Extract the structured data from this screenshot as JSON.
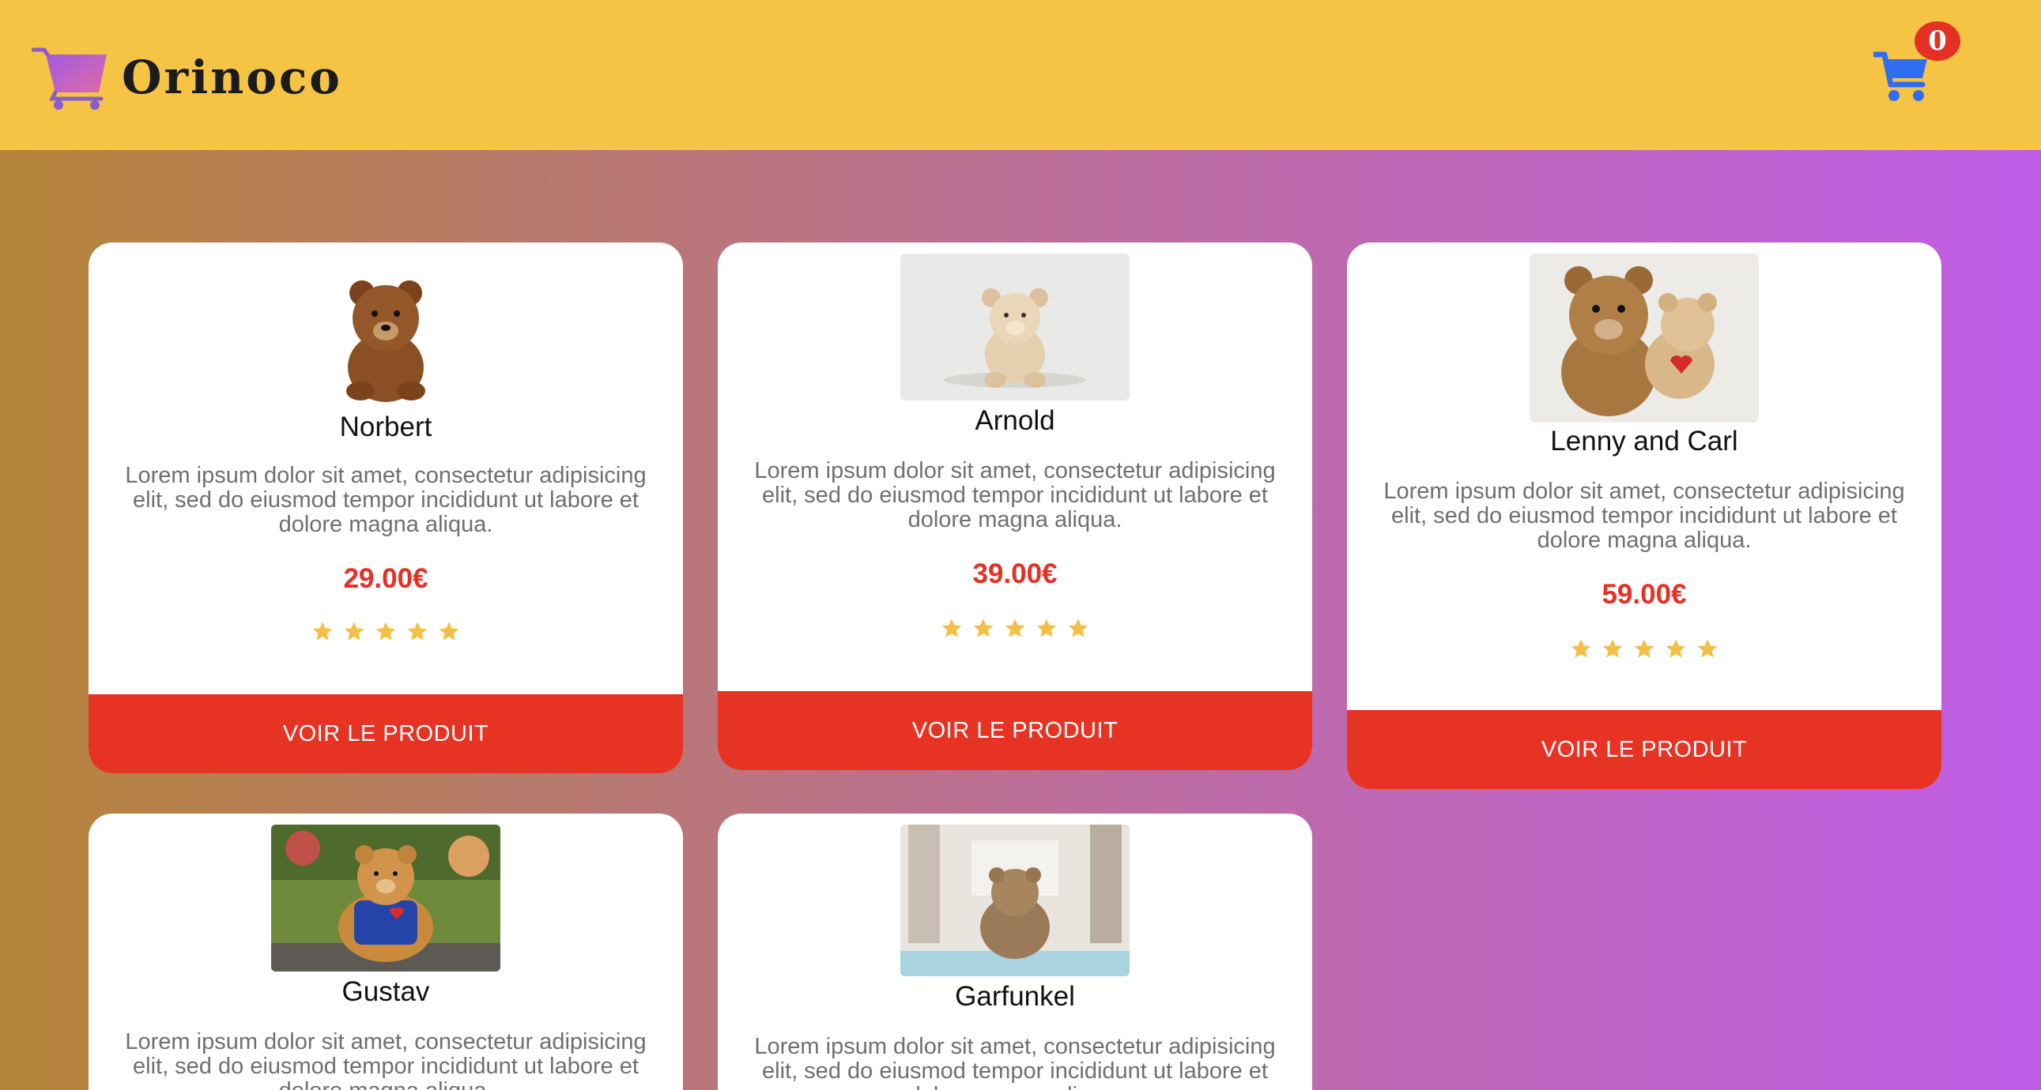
{
  "header": {
    "logo_text": "Orinoco",
    "cart_count": "0"
  },
  "products": [
    {
      "name": "Norbert",
      "description": "Lorem ipsum dolor sit amet, consectetur adipisicing elit, sed do eiusmod tempor incididunt ut labore et dolore magna aliqua.",
      "price": "29.00€",
      "rating": 5,
      "button": "VOIR LE PRODUIT"
    },
    {
      "name": "Arnold",
      "description": "Lorem ipsum dolor sit amet, consectetur adipisicing elit, sed do eiusmod tempor incididunt ut labore et dolore magna aliqua.",
      "price": "39.00€",
      "rating": 5,
      "button": "VOIR LE PRODUIT"
    },
    {
      "name": "Lenny and Carl",
      "description": "Lorem ipsum dolor sit amet, consectetur adipisicing elit, sed do eiusmod tempor incididunt ut labore et dolore magna aliqua.",
      "price": "59.00€",
      "rating": 5,
      "button": "VOIR LE PRODUIT"
    },
    {
      "name": "Gustav",
      "description": "Lorem ipsum dolor sit amet, consectetur adipisicing elit, sed do eiusmod tempor incididunt ut labore et dolore magna aliqua."
    },
    {
      "name": "Garfunkel",
      "description": "Lorem ipsum dolor sit amet, consectetur adipisicing elit, sed do eiusmod tempor incididunt ut labore et dolore magna aliqua."
    }
  ]
}
